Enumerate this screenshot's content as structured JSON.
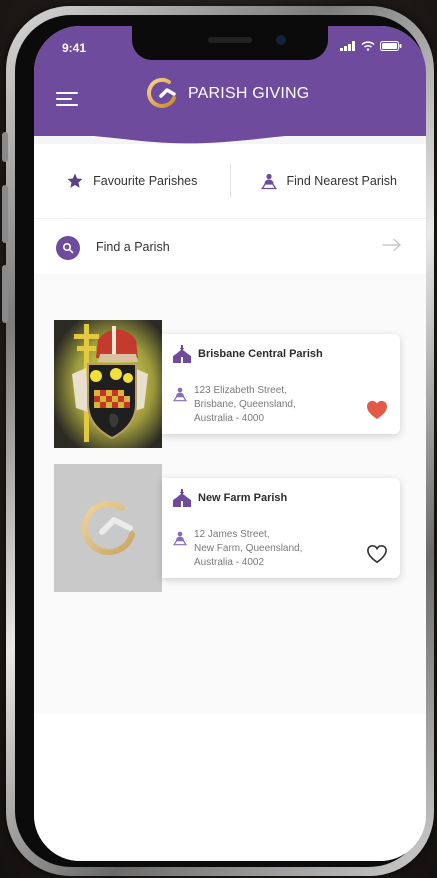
{
  "status_bar": {
    "time": "9:41"
  },
  "header": {
    "brand_name": "PARISH GIVING",
    "brand_color": "#6e4b9c",
    "menu_icon": "hamburger-icon"
  },
  "quick_actions": [
    {
      "label": "Favourite Parishes",
      "icon": "star-icon"
    },
    {
      "label": "Find Nearest Parish",
      "icon": "location-person-icon"
    }
  ],
  "search": {
    "label": "Find a Parish",
    "icon": "search-icon",
    "action_icon": "arrow-right-icon"
  },
  "parishes": [
    {
      "name": "Brisbane Central Parish",
      "address_lines": [
        "123 Elizabeth Street,",
        "Brisbane, Queensland,",
        "Australia - 4000"
      ],
      "favourite": true,
      "heart_color": "#e05a47",
      "image": "coat-of-arms"
    },
    {
      "name": "New Farm Parish",
      "address_lines": [
        "12 James Street,",
        "New Farm, Queensland,",
        "Australia - 4002"
      ],
      "favourite": false,
      "heart_color": "#333333",
      "image": "logo-placeholder"
    }
  ]
}
